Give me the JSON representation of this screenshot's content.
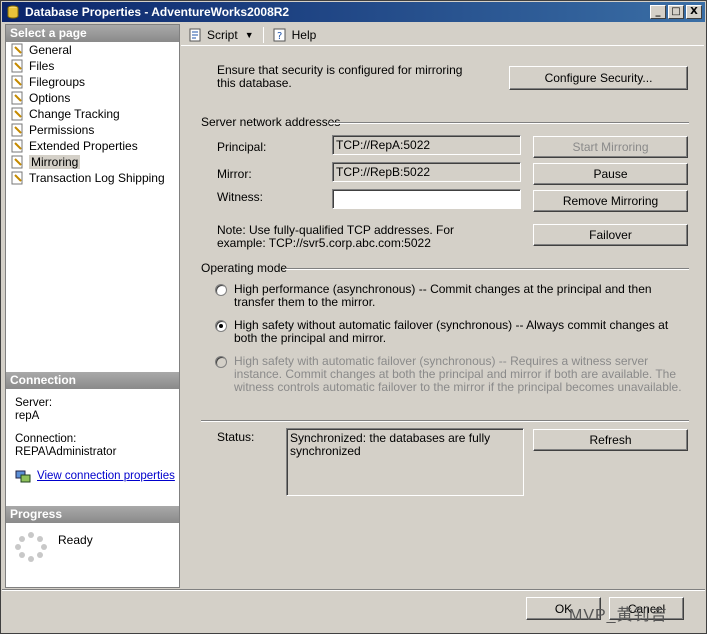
{
  "window": {
    "title": "Database Properties - AdventureWorks2008R2",
    "controls": [
      "_",
      "□",
      "X"
    ]
  },
  "left": {
    "select_page_header": "Select a page",
    "pages": [
      {
        "label": "General"
      },
      {
        "label": "Files"
      },
      {
        "label": "Filegroups"
      },
      {
        "label": "Options"
      },
      {
        "label": "Change Tracking"
      },
      {
        "label": "Permissions"
      },
      {
        "label": "Extended Properties"
      },
      {
        "label": "Mirroring",
        "selected": true
      },
      {
        "label": "Transaction Log Shipping"
      }
    ],
    "connection_header": "Connection",
    "server_label": "Server:",
    "server_value": "repA",
    "connection_label": "Connection:",
    "connection_value": "REPA\\Administrator",
    "view_connection_link": "View connection properties",
    "progress_header": "Progress",
    "progress_status": "Ready"
  },
  "toolbar": {
    "script_label": "Script",
    "help_label": "Help"
  },
  "mirroring": {
    "security_note": "Ensure that security is configured for mirroring this database.",
    "configure_security_button": "Configure Security...",
    "server_network_header": "Server network addresses",
    "principal_label": "Principal:",
    "principal_value": "TCP://RepA:5022",
    "mirror_label": "Mirror:",
    "mirror_value": "TCP://RepB:5022",
    "witness_label": "Witness:",
    "witness_value": "",
    "start_mirroring_button": "Start Mirroring",
    "pause_button": "Pause",
    "remove_mirroring_button": "Remove Mirroring",
    "failover_button": "Failover",
    "address_note": "Note: Use fully-qualified TCP addresses. For example: TCP://svr5.corp.abc.com:5022",
    "operating_mode_header": "Operating mode",
    "modes": [
      {
        "label": "High performance (asynchronous) -- Commit changes at the principal and then transfer them to the mirror.",
        "checked": false,
        "enabled": true
      },
      {
        "label": "High safety without automatic failover (synchronous) -- Always commit changes at both the principal and mirror.",
        "checked": true,
        "enabled": true
      },
      {
        "label": "High safety with automatic failover (synchronous) -- Requires a witness server instance. Commit changes at both the principal and mirror if both are available. The witness controls automatic failover to the mirror if the principal becomes unavailable.",
        "checked": false,
        "enabled": false
      }
    ],
    "status_label": "Status:",
    "status_value": "Synchronized: the databases are fully synchronized",
    "refresh_button": "Refresh"
  },
  "footer": {
    "ok_button": "OK",
    "cancel_button": "Cancel",
    "watermark": "MVP_黄钊吉"
  }
}
